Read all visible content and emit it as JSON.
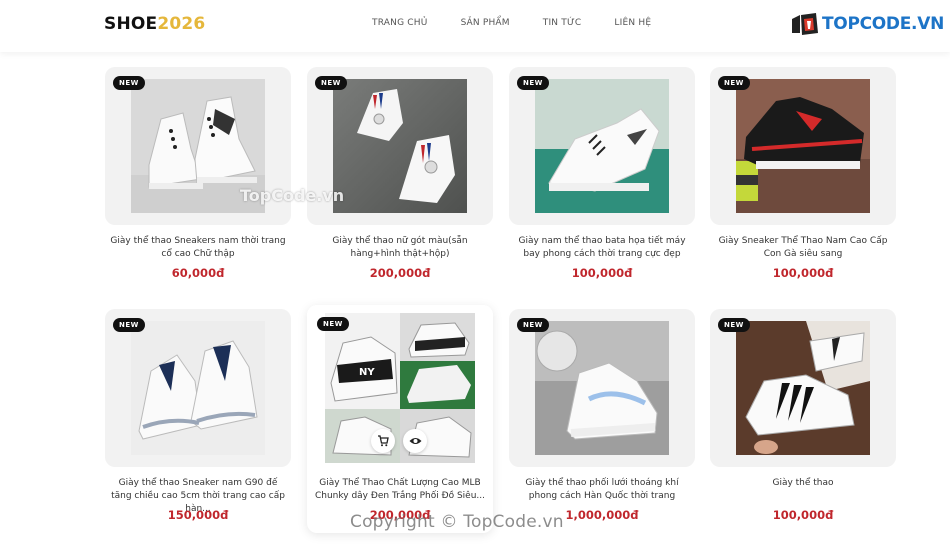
{
  "header": {
    "logo_main": "SHOE",
    "logo_year": "2026",
    "nav": [
      "TRANG CHỦ",
      "SẢN PHẨM",
      "TIN TỨC",
      "LIÊN HỆ"
    ],
    "brand": "TOPCODE.VN"
  },
  "products": [
    {
      "badge": "NEW",
      "title": "Giày thể thao Sneakers nam thời trang cổ cao Chữ thập",
      "price": "60,000đ"
    },
    {
      "badge": "NEW",
      "title": "Giày thể thao nữ gót màu(sẵn hàng+hình thật+hộp)",
      "price": "200,000đ"
    },
    {
      "badge": "NEW",
      "title": "Giày nam thể thao bata họa tiết máy bay phong cách thời trang cực đẹp",
      "price": "100,000đ"
    },
    {
      "badge": "NEW",
      "title": "Giày Sneaker Thể Thao Nam Cao Cấp Con Gà siêu sang",
      "price": "100,000đ"
    },
    {
      "badge": "NEW",
      "title": "Giày thể thao Sneaker nam G90 đế tăng chiều cao 5cm thời trang cao cấp hàn...",
      "price": "150,000đ"
    },
    {
      "badge": "NEW",
      "title": "Giày Thể Thao Chất Lượng Cao MLB Chunky dây Đen Trắng Phối Đồ Siêu...",
      "price": "200,000đ"
    },
    {
      "badge": "NEW",
      "title": "Giày thể thao phối lưới thoáng khí phong cách Hàn Quốc thời trang",
      "price": "1,000,000đ"
    },
    {
      "badge": "NEW",
      "title": "Giày thể thao",
      "price": "100,000đ"
    }
  ],
  "watermark": "TopCode.vn",
  "copyright": "Copyright © TopCode.vn",
  "colors": {
    "accent": "#e5b73b",
    "price": "#c0272d",
    "brand": "#1d74c7"
  }
}
